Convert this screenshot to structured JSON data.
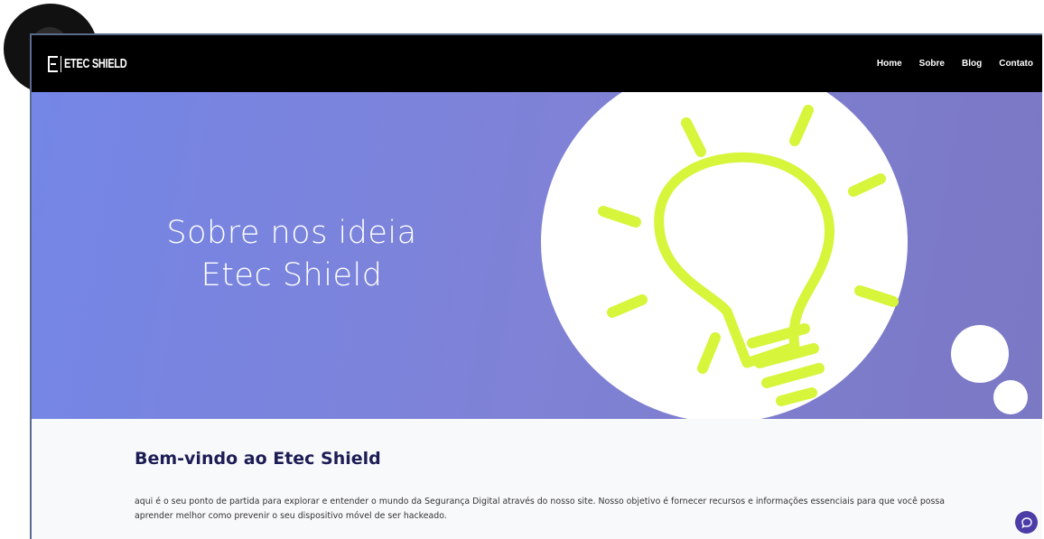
{
  "brand": {
    "logo_text": "ETEC SHIELD"
  },
  "nav": {
    "items": [
      {
        "label": "Home"
      },
      {
        "label": "Sobre"
      },
      {
        "label": "Blog"
      },
      {
        "label": "Contato"
      }
    ]
  },
  "hero": {
    "title_line1": "Sobre nos ideia",
    "title_line2": "Etec Shield",
    "illustration_icon": "lightbulb-icon"
  },
  "content": {
    "heading": "Bem-vindo ao Etec Shield",
    "paragraph": "aqui é o seu ponto de partida para explorar e entender o mundo da Segurança Digital através do nosso site. Nosso objetivo é fornecer recursos e informações essenciais para que você possa aprender melhor como prevenir o seu dispositivo móvel de ser hackeado."
  },
  "chat": {
    "icon": "chat-bubble-icon"
  },
  "colors": {
    "navbar": "#000000",
    "hero_background": "#7f82d6",
    "bulb": "#d7f53a",
    "heading": "#1d1d55",
    "chat_button": "#4b3ca8"
  }
}
